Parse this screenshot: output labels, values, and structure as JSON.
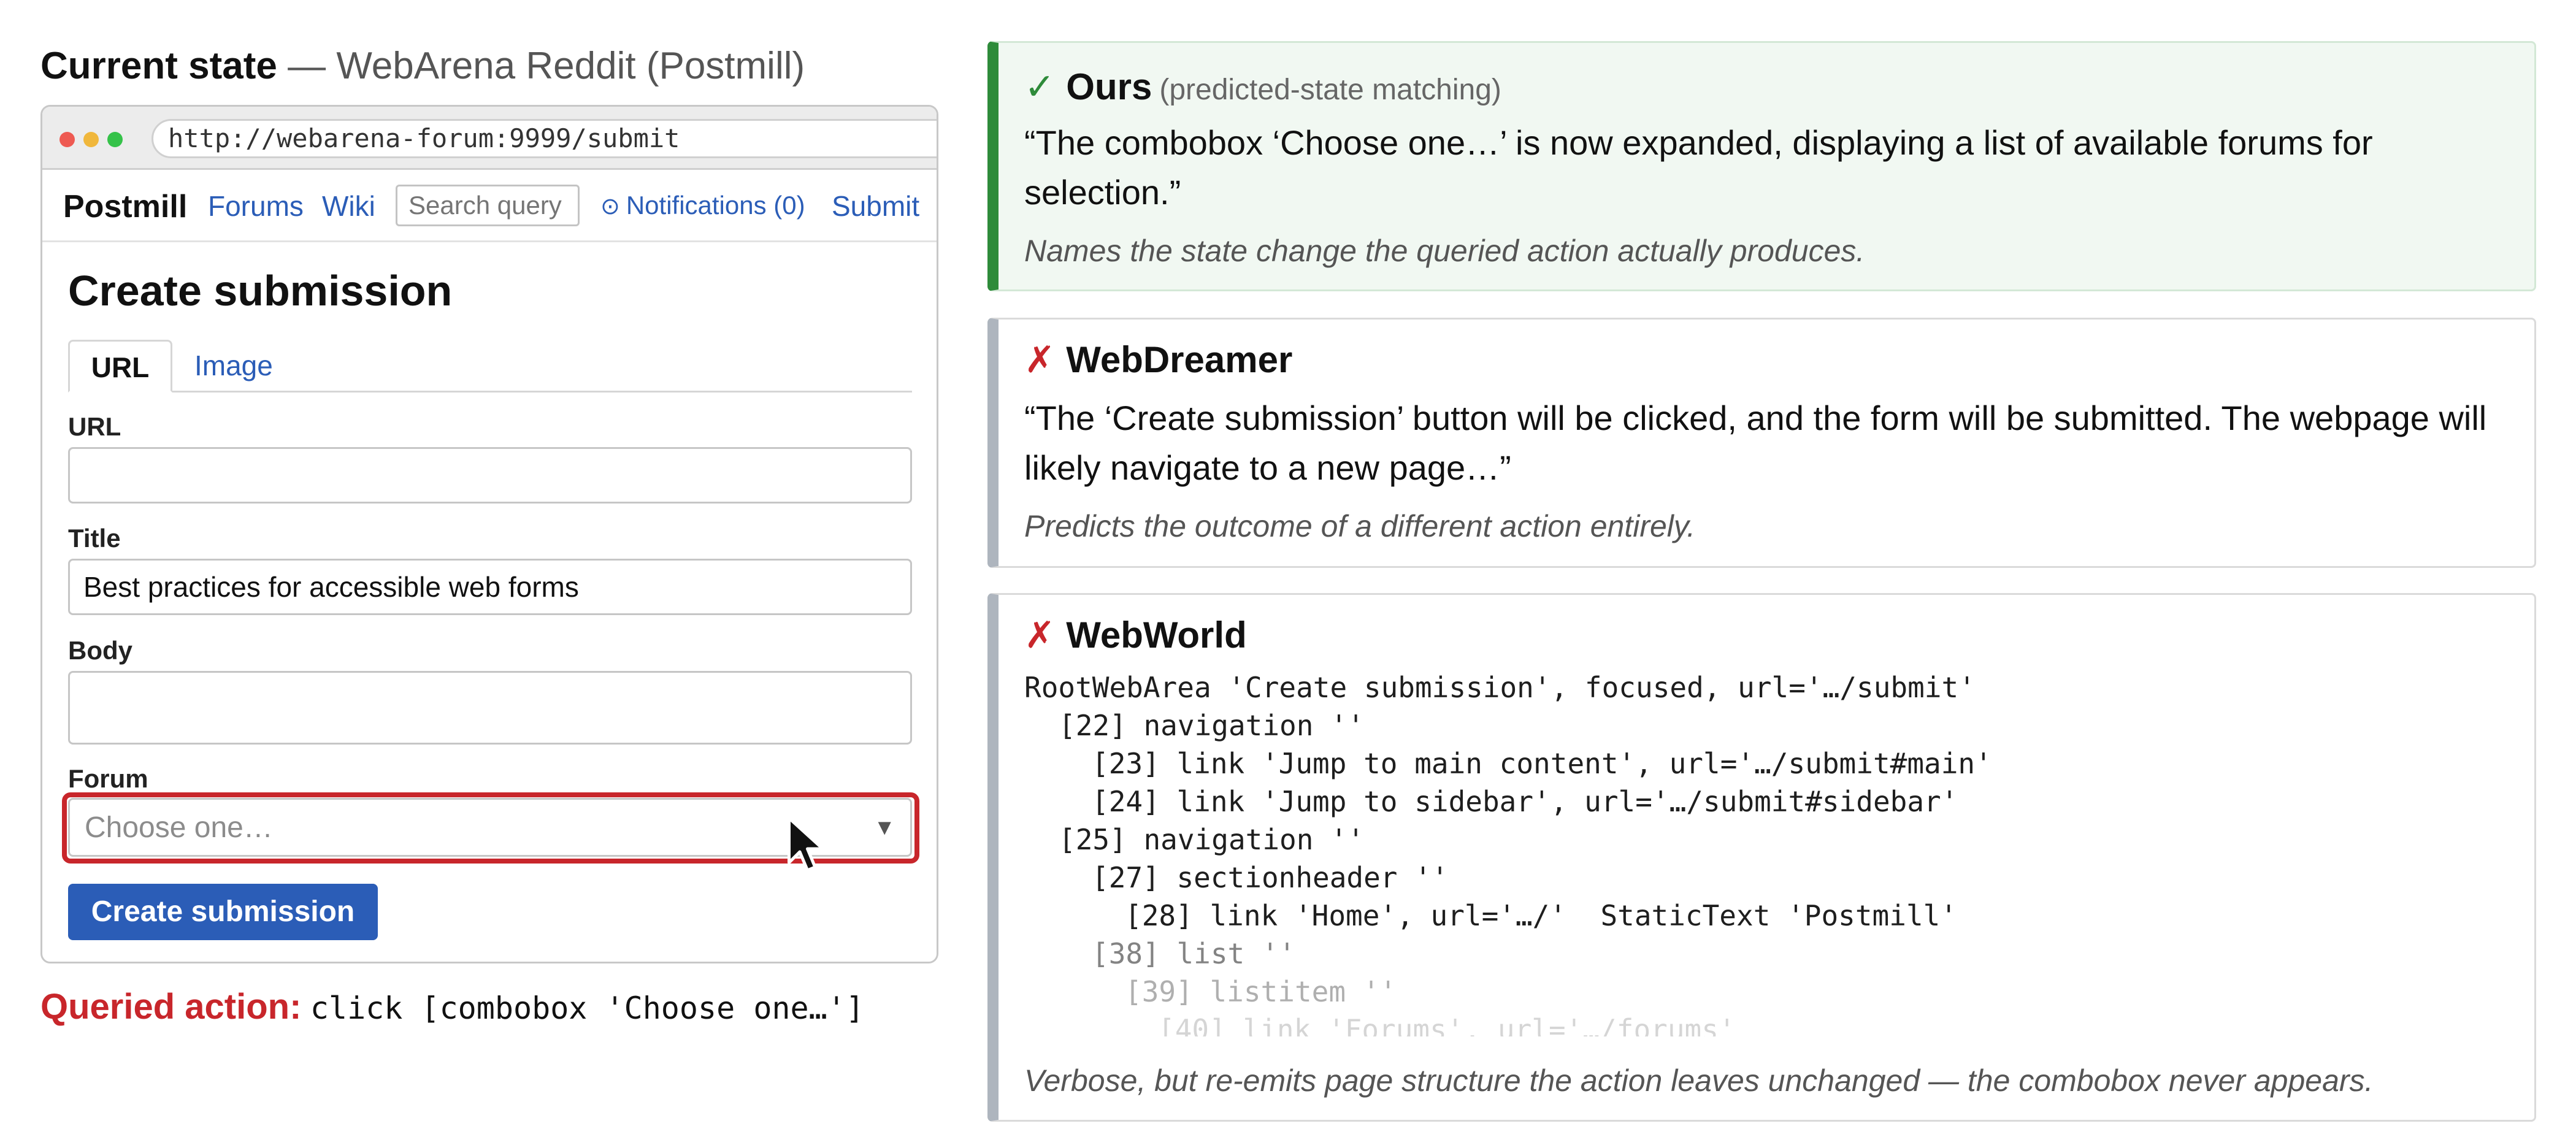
{
  "left": {
    "heading": {
      "title": "Current state",
      "dash": "—",
      "subtitle": "WebArena Reddit (Postmill)"
    },
    "browser": {
      "url": "http://webarena-forum:9999/submit"
    },
    "navbar": {
      "brand": "Postmill",
      "forums": "Forums",
      "wiki": "Wiki",
      "search_placeholder": "Search query",
      "notifications_icon": "clock-icon",
      "notifications": "Notifications (0)",
      "submit": "Submit"
    },
    "form": {
      "title": "Create submission",
      "tabs": [
        "URL",
        "Image"
      ],
      "url_label": "URL",
      "url_value": "",
      "title_label": "Title",
      "title_value": "Best practices for accessible web forms",
      "body_label": "Body",
      "body_value": "",
      "forum_label": "Forum",
      "forum_placeholder": "Choose one…",
      "submit_button": "Create submission"
    },
    "queried": {
      "label": "Queried action:",
      "action": "click [combobox 'Choose one…']"
    }
  },
  "cards": {
    "ours": {
      "mark": "✓",
      "name": "Ours",
      "subtitle": "(predicted-state matching)",
      "quote": "“The combobox ‘Choose one…’ is now expanded, displaying a list of available forums for selection.”",
      "note": "Names the state change the queried action actually produces."
    },
    "webdreamer": {
      "mark": "✗",
      "name": "WebDreamer",
      "quote": "“The ‘Create submission’ button will be clicked, and the form will be submitted. The webpage will likely navigate to a new page…”",
      "note": "Predicts the outcome of a different action entirely."
    },
    "webworld": {
      "mark": "✗",
      "name": "WebWorld",
      "tree": [
        "RootWebArea 'Create submission', focused, url='…/submit'",
        "[22] navigation ''",
        "[23] link 'Jump to main content', url='…/submit#main'",
        "[24] link 'Jump to sidebar', url='…/submit#sidebar'",
        "[25] navigation ''",
        "[27] sectionheader ''",
        "[28] link 'Home', url='…/'  StaticText 'Postmill'",
        "[38] list ''",
        "[39] listitem ''",
        "[40] link 'Forums', url='…/forums'"
      ],
      "note": "Verbose, but re-emits page structure the action leaves unchanged — the combobox never appears."
    }
  },
  "colors": {
    "accent_green": "#2e8b3a",
    "accent_red": "#c8262b",
    "link_blue": "#2b5db7",
    "neutral_bar": "#aeb5be"
  }
}
